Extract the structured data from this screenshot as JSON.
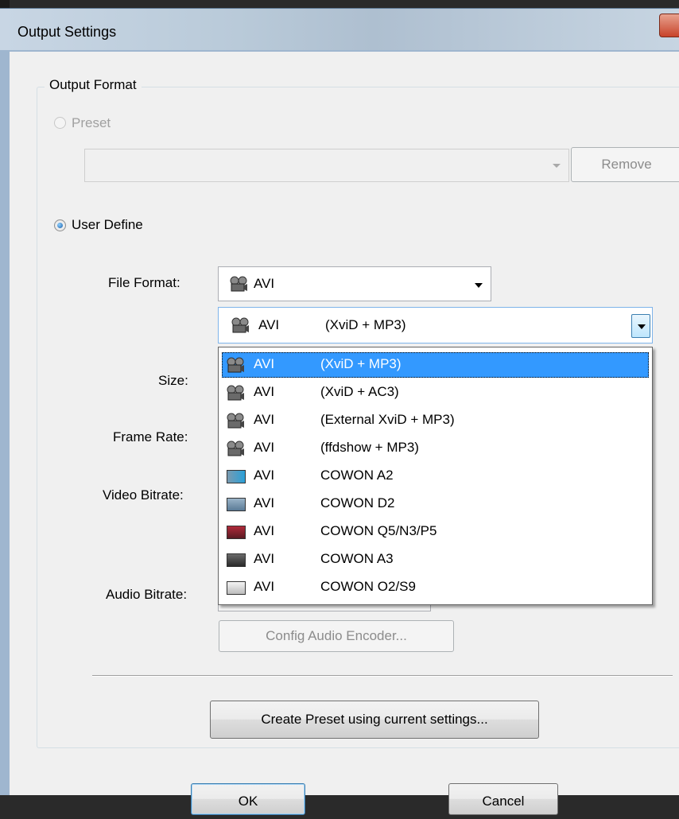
{
  "window": {
    "title": "Output Settings"
  },
  "output_format": {
    "group_label": "Output Format",
    "preset_label": "Preset",
    "preset_value": "",
    "remove_label": "Remove",
    "user_define_label": "User Define",
    "file_format_label": "File Format:",
    "file_format_value": "AVI",
    "codec_selected": {
      "format": "AVI",
      "codec": "(XviD + MP3)"
    },
    "size_label": "Size:",
    "frame_rate_label": "Frame Rate:",
    "video_bitrate_label": "Video Bitrate:",
    "audio_bitrate_label": "Audio Bitrate:",
    "config_audio_label": "Config Audio Encoder...",
    "create_preset_label": "Create Preset using current settings..."
  },
  "codec_options": [
    {
      "format": "AVI",
      "codec": "(XviD + MP3)",
      "icon": "film-reel-icon",
      "selected": true
    },
    {
      "format": "AVI",
      "codec": "(XviD + AC3)",
      "icon": "film-reel-icon"
    },
    {
      "format": "AVI",
      "codec": "(External XviD + MP3)",
      "icon": "film-reel-icon"
    },
    {
      "format": "AVI",
      "codec": "(ffdshow + MP3)",
      "icon": "film-reel-icon"
    },
    {
      "format": "AVI",
      "codec": "COWON A2",
      "icon": "cowon-a2-device-icon"
    },
    {
      "format": "AVI",
      "codec": "COWON D2",
      "icon": "cowon-d2-device-icon"
    },
    {
      "format": "AVI",
      "codec": "COWON Q5/N3/P5",
      "icon": "cowon-q5-device-icon"
    },
    {
      "format": "AVI",
      "codec": "COWON A3",
      "icon": "cowon-a3-device-icon"
    },
    {
      "format": "AVI",
      "codec": "COWON O2/S9",
      "icon": "cowon-o2-device-icon"
    }
  ],
  "buttons": {
    "ok": "OK",
    "cancel": "Cancel"
  },
  "colors": {
    "selection": "#3399ff",
    "titlebar": "#b9cad9",
    "dialog_bg": "#f0f0f0"
  }
}
